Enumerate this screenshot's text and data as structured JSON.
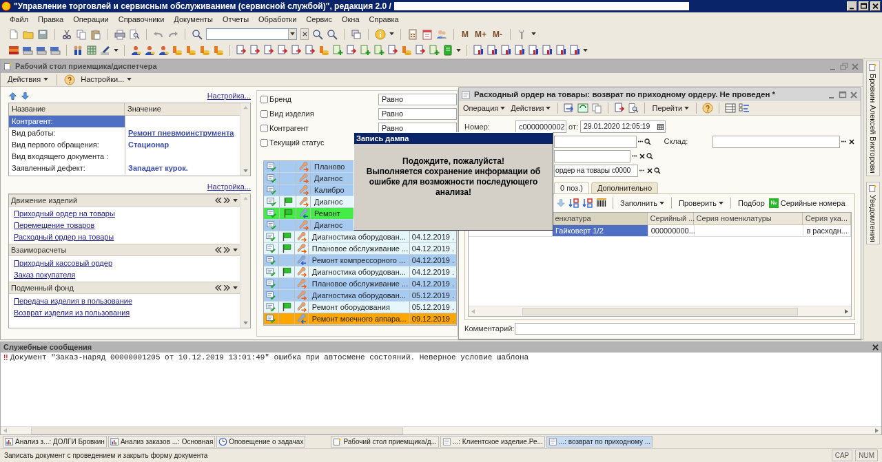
{
  "window": {
    "title": "\"Управление торговлей и сервисным обслуживанием (сервисной службой)\", редакция 2.0 /"
  },
  "menu": [
    "Файл",
    "Правка",
    "Операции",
    "Справочники",
    "Документы",
    "Отчеты",
    "Обработки",
    "Сервис",
    "Окна",
    "Справка"
  ],
  "toolbar": {
    "memory_buttons": [
      "M",
      "M+",
      "M-"
    ]
  },
  "desktop": {
    "title": "Рабочий стол приемщика/диспетчера",
    "actions": [
      "Действия",
      "Настройки..."
    ],
    "settings_link": "Настройка...",
    "properties": {
      "columns": [
        "Название",
        "Значение"
      ],
      "rows": [
        {
          "name": "Контрагент:",
          "value": "",
          "selected": true
        },
        {
          "name": "Вид работы:",
          "value": "Ремонт пневмоинструмента",
          "selected": false
        },
        {
          "name": "Вид первого обращения:",
          "value": "Стационар",
          "selected": false
        },
        {
          "name": "Вид входящего документа :",
          "value": "",
          "selected": false
        },
        {
          "name": "Заявленный дефект:",
          "value": "Западает курок.",
          "selected": false
        }
      ]
    },
    "groups_link": "Настройка...",
    "groups": [
      {
        "title": "Движение изделий",
        "links": [
          "Приходный ордер на товары",
          "Перемещение товаров",
          "Расходный ордер на товары"
        ]
      },
      {
        "title": "Взаиморасчеты",
        "links": [
          "Приходный кассовый ордер",
          "Заказ покупателя"
        ]
      },
      {
        "title": "Подменный фонд",
        "links": [
          "Передача изделия в пользование",
          "Возврат изделия из пользования"
        ]
      }
    ],
    "filters": [
      {
        "label": "Бренд",
        "checked": false,
        "condition": "Равно"
      },
      {
        "label": "Вид изделия",
        "checked": false,
        "condition": "Равно"
      },
      {
        "label": "Контрагент",
        "checked": false,
        "condition": "Равно"
      },
      {
        "label": "Текущий статус",
        "checked": false
      }
    ],
    "orders": [
      {
        "name": "Планово",
        "flag": false,
        "kind": "out",
        "color": "#a6caf0"
      },
      {
        "name": "Диагнос",
        "flag": false,
        "kind": "out",
        "color": "#a6caf0"
      },
      {
        "name": "Калибро",
        "flag": false,
        "kind": "out",
        "color": "#a6caf0"
      },
      {
        "name": "Диагнос",
        "flag": true,
        "kind": "out",
        "color": "#e6f7fb"
      },
      {
        "name": "Ремонт",
        "flag": true,
        "kind": "in",
        "color": "#46ec46"
      },
      {
        "name": "Диагнос",
        "flag": false,
        "kind": "out",
        "color": "#a6caf0"
      },
      {
        "name": "Диагностика оборудован...",
        "date": "04.12.2019 .",
        "flag": true,
        "kind": "out",
        "color": "#e6f7fb"
      },
      {
        "name": "Плановое обслуживание ...",
        "date": "04.12.2019 .",
        "flag": true,
        "kind": "out",
        "color": "#e6f7fb"
      },
      {
        "name": "Ремонт компрессорного ...",
        "date": "04.12.2019 .",
        "flag": false,
        "kind": "in",
        "color": "#a6caf0"
      },
      {
        "name": "Диагностика оборудован...",
        "date": "04.12.2019 .",
        "flag": true,
        "kind": "out",
        "color": "#e6f7fb"
      },
      {
        "name": "Плановое обслуживание ...",
        "date": "04.12.2019 .",
        "flag": false,
        "kind": "out",
        "color": "#a6caf0"
      },
      {
        "name": "Диагностика оборудован...",
        "date": "05.12.2019 .",
        "flag": false,
        "kind": "out",
        "color": "#a6caf0"
      },
      {
        "name": "Ремонт оборудования",
        "date": "05.12.2019 .",
        "flag": true,
        "kind": "out",
        "color": "#e6f7fb"
      },
      {
        "name": "Ремонт моечного аппара...",
        "date": "09.12.2019 .",
        "flag": false,
        "kind": "in",
        "color": "#ffa500"
      }
    ]
  },
  "document": {
    "title": "Расходный ордер на товары: возврат по приходному ордеру. Не проведен *",
    "menus": [
      "Операция",
      "Действия",
      "Перейти"
    ],
    "number_label": "Номер:",
    "number": "c0000000002",
    "date_label": "от:",
    "date": "29.01.2020 12:05:19",
    "warehouse_label": "Склад:",
    "base_document": "ордер на товары с0000",
    "tabs": [
      {
        "label": "0 поз.)",
        "selected": true
      },
      {
        "label": "Дополнительно",
        "selected": false
      }
    ],
    "table_toolbar": [
      {
        "kind": "dropdown",
        "label": "Заполнить"
      },
      {
        "kind": "dropdown",
        "label": "Проверить"
      },
      {
        "kind": "button",
        "label": "Подбор"
      },
      {
        "kind": "serial",
        "badge": "№",
        "label": "Серийные номера"
      }
    ],
    "columns": [
      "енклатура",
      "Серийный ...",
      "Серия номенклатуры",
      "Серия ука..."
    ],
    "rows": [
      {
        "cells": [
          "Гайковерт 1/2",
          "000000000...",
          "",
          "в расходн..."
        ],
        "selected": true
      }
    ],
    "comment_label": "Комментарий:"
  },
  "dump_dialog": {
    "title": "Запись дампа",
    "message": "Подождите, пожалуйста!\nВыполняется сохранение информации об\nошибке для возможности последующего\nанализа!"
  },
  "side_panel": [
    "Бровкин Алексей Викторови",
    "Уведомления"
  ],
  "messages": {
    "title": "Служебные сообщения",
    "items": [
      {
        "marker": "!!",
        "text": "Документ \"Заказ-наряд 00000001205 от 10.12.2019 13:01:49\" ошибка при автосмене состояний. Неверное условие шаблона"
      }
    ]
  },
  "taskbar": [
    {
      "kind": "report",
      "label": "Анализ з...: ДОЛГИ Бровкин",
      "selected": false
    },
    {
      "kind": "report",
      "label": "Анализ заказов ...: Основная",
      "selected": false
    },
    {
      "kind": "clock",
      "label": "Оповещение о задачах",
      "selected": false
    },
    {
      "kind": "desktop",
      "label": "Рабочий стол приемщика/д...",
      "selected": false
    },
    {
      "kind": "form",
      "label": "...: Клиентское изделие.Ре...",
      "selected": false
    },
    {
      "kind": "form",
      "label": "...: возврат по приходному ...",
      "selected": true
    }
  ],
  "status_bar": {
    "text": "Записать документ с проведением и закрыть форму документа",
    "indicators": [
      "CAP",
      "NUM"
    ]
  }
}
